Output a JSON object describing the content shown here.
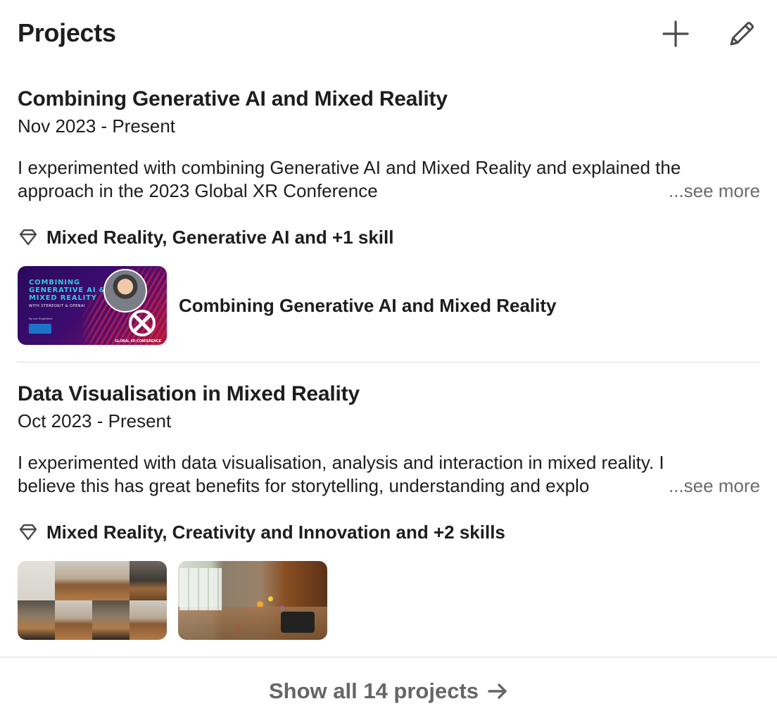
{
  "section": {
    "title": "Projects"
  },
  "header_icons": {
    "add": "plus-icon",
    "edit": "pencil-icon"
  },
  "projects": [
    {
      "title": "Combining Generative AI and Mixed Reality",
      "date": "Nov 2023 - Present",
      "description_line1": "I experimented with combining Generative AI and Mixed Reality and explained the",
      "description_line2": "approach in the 2023 Global XR Conference",
      "see_more": "...see more",
      "skills": "Mixed Reality, Generative AI and +1 skill",
      "media_title": "Combining Generative AI and Mixed Reality",
      "thumbnail_text": {
        "line1": "COMBINING",
        "line2": "GENERATIVE AI &",
        "line3": "MIXED REALITY",
        "subtitle": "WITH STEREOKIT & OPENAI",
        "author": "By Lee Englestone",
        "caption": "GLOBAL XR CONFERENCE"
      }
    },
    {
      "title": "Data Visualisation in Mixed Reality",
      "date": "Oct 2023 - Present",
      "description_line1": "I experimented with data visualisation, analysis and interaction in mixed reality. I",
      "description_line2": "believe this has great benefits for storytelling, understanding and explo",
      "see_more": "...see more",
      "skills": "Mixed Reality, Creativity and Innovation and +2 skills"
    }
  ],
  "footer": {
    "label": "Show all 14 projects",
    "icon": "arrow-right-icon"
  },
  "colors": {
    "text_primary": "#1d1d1d",
    "text_secondary": "#666666",
    "divider": "#dcdcdc",
    "see_more": "#6b6b6b"
  }
}
